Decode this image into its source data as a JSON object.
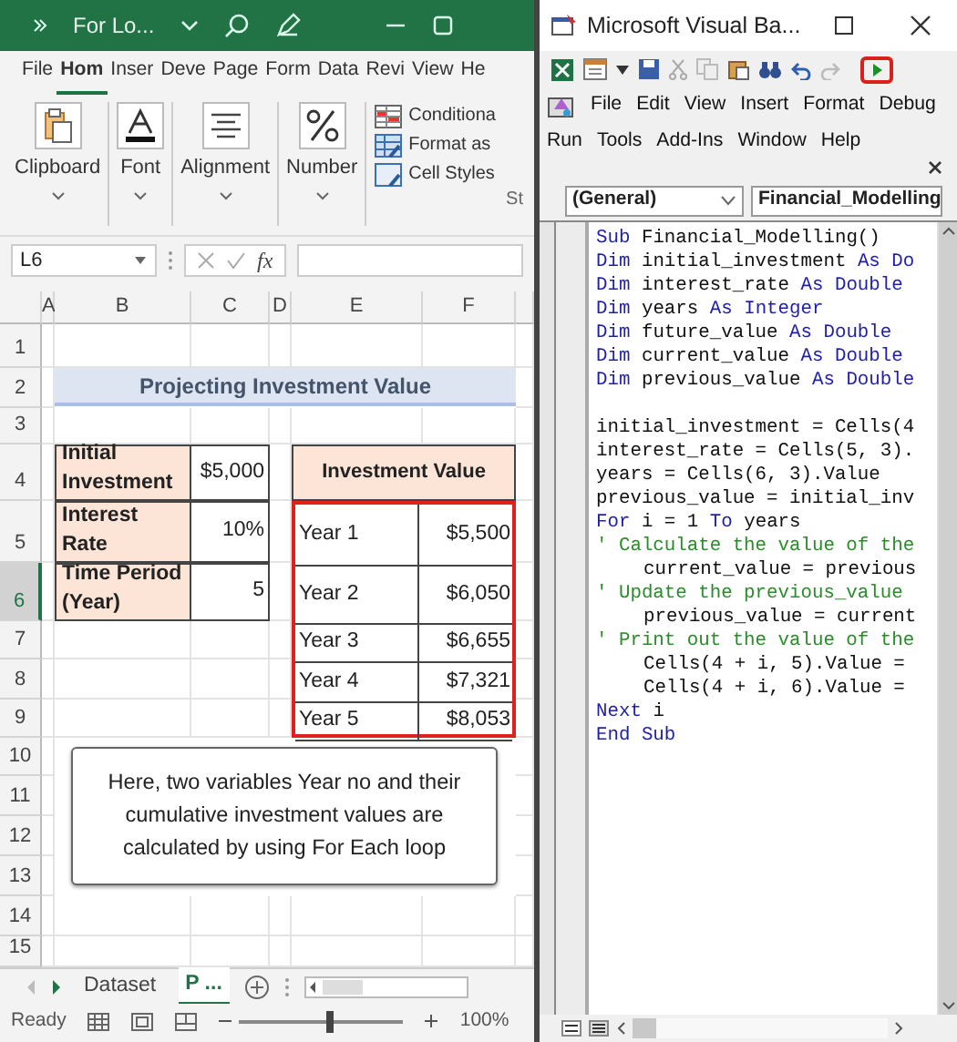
{
  "excel": {
    "title": "For Lo...",
    "ribbon_tabs": [
      {
        "label": "File",
        "selected": false
      },
      {
        "label": "Hom",
        "selected": true
      },
      {
        "label": "Inser",
        "selected": false
      },
      {
        "label": "Deve",
        "selected": false
      },
      {
        "label": "Page",
        "selected": false
      },
      {
        "label": "Form",
        "selected": false
      },
      {
        "label": "Data",
        "selected": false
      },
      {
        "label": "Revi",
        "selected": false
      },
      {
        "label": "View",
        "selected": false
      },
      {
        "label": "He",
        "selected": false
      }
    ],
    "ribbon_groups": [
      {
        "label": "Clipboard",
        "kind": "clipboard"
      },
      {
        "label": "Font",
        "kind": "font"
      },
      {
        "label": "Alignment",
        "kind": "alignment"
      },
      {
        "label": "Number",
        "kind": "number"
      }
    ],
    "styles_items": [
      {
        "label": "Conditiona",
        "kind": "conditional"
      },
      {
        "label": "Format as",
        "kind": "table"
      },
      {
        "label": "Cell Styles",
        "kind": "cellstyles"
      }
    ],
    "styles_group_label": "St",
    "name_box": "L6",
    "function_label": "fx",
    "columns": [
      "A",
      "B",
      "C",
      "D",
      "E",
      "F"
    ],
    "rows": [
      {
        "label": "1",
        "selected": false
      },
      {
        "label": "2",
        "selected": false
      },
      {
        "label": "3",
        "selected": false
      },
      {
        "label": "4",
        "selected": false
      },
      {
        "label": "5",
        "selected": false
      },
      {
        "label": "6",
        "selected": true
      },
      {
        "label": "7",
        "selected": false
      },
      {
        "label": "8",
        "selected": false
      },
      {
        "label": "9",
        "selected": false
      },
      {
        "label": "10",
        "selected": false
      },
      {
        "label": "11",
        "selected": false
      },
      {
        "label": "12",
        "selected": false
      },
      {
        "label": "13",
        "selected": false
      },
      {
        "label": "14",
        "selected": false
      },
      {
        "label": "15",
        "selected": false
      }
    ],
    "banner": "Projecting Investment Value",
    "inputs": [
      {
        "label": "Initial Investment",
        "value": "$5,000"
      },
      {
        "label": "Interest Rate",
        "value": "10%"
      },
      {
        "label": "Time Period (Year)",
        "value": "5"
      }
    ],
    "results_header": "Investment Value",
    "results": [
      {
        "year": "Year 1",
        "value": "$5,500"
      },
      {
        "year": "Year 2",
        "value": "$6,050"
      },
      {
        "year": "Year 3",
        "value": "$6,655"
      },
      {
        "year": "Year 4",
        "value": "$7,321"
      },
      {
        "year": "Year 5",
        "value": "$8,053"
      }
    ],
    "note": "Here, two variables Year no and their cumulative investment values are calculated by using For Each loop",
    "sheet_tabs": [
      {
        "label": "Dataset",
        "selected": false
      },
      {
        "label": "P ...",
        "selected": true
      }
    ],
    "status": "Ready",
    "zoom": {
      "level": 0.55,
      "reading": "100%"
    }
  },
  "vba": {
    "title": "Microsoft Visual Ba...",
    "menu": [
      "File",
      "Edit",
      "View",
      "Insert",
      "Format",
      "Debug",
      "Run",
      "Tools",
      "Add-Ins",
      "Window",
      "Help"
    ],
    "object_box": "(General)",
    "procedure_box": "Financial_Modelling",
    "code": [
      {
        "segments": [
          {
            "kind": "kw",
            "text": "Sub "
          },
          {
            "kind": "tx",
            "text": "Financial_Modelling()"
          }
        ]
      },
      {
        "segments": [
          {
            "kind": "kw",
            "text": "Dim "
          },
          {
            "kind": "tx",
            "text": "initial_investment "
          },
          {
            "kind": "kw",
            "text": "As Do"
          }
        ]
      },
      {
        "segments": [
          {
            "kind": "kw",
            "text": "Dim "
          },
          {
            "kind": "tx",
            "text": "interest_rate "
          },
          {
            "kind": "kw",
            "text": "As Double"
          }
        ]
      },
      {
        "segments": [
          {
            "kind": "kw",
            "text": "Dim "
          },
          {
            "kind": "tx",
            "text": "years "
          },
          {
            "kind": "kw",
            "text": "As Integer"
          }
        ]
      },
      {
        "segments": [
          {
            "kind": "kw",
            "text": "Dim "
          },
          {
            "kind": "tx",
            "text": "future_value "
          },
          {
            "kind": "kw",
            "text": "As Double"
          }
        ]
      },
      {
        "segments": [
          {
            "kind": "kw",
            "text": "Dim "
          },
          {
            "kind": "tx",
            "text": "current_value "
          },
          {
            "kind": "kw",
            "text": "As Double"
          }
        ]
      },
      {
        "segments": [
          {
            "kind": "kw",
            "text": "Dim "
          },
          {
            "kind": "tx",
            "text": "previous_value "
          },
          {
            "kind": "kw",
            "text": "As Double"
          }
        ]
      },
      {
        "blank_before": true,
        "segments": [
          {
            "kind": "tx",
            "text": "initial_investment = Cells(4"
          }
        ]
      },
      {
        "segments": [
          {
            "kind": "tx",
            "text": "interest_rate = Cells(5, 3)."
          }
        ]
      },
      {
        "segments": [
          {
            "kind": "tx",
            "text": "years = Cells(6, 3).Value"
          }
        ]
      },
      {
        "segments": [
          {
            "kind": "tx",
            "text": "previous_value = initial_inv"
          }
        ]
      },
      {
        "segments": [
          {
            "kind": "kw",
            "text": "For "
          },
          {
            "kind": "tx",
            "text": "i = 1 "
          },
          {
            "kind": "kw",
            "text": "To "
          },
          {
            "kind": "tx",
            "text": "years"
          }
        ]
      },
      {
        "segments": [
          {
            "kind": "cm",
            "text": "' Calculate the value of the"
          }
        ]
      },
      {
        "indented": true,
        "segments": [
          {
            "kind": "tx",
            "text": "current_value = previous"
          }
        ]
      },
      {
        "segments": [
          {
            "kind": "cm",
            "text": "' Update the previous_value"
          }
        ]
      },
      {
        "indented": true,
        "segments": [
          {
            "kind": "tx",
            "text": "previous_value = current"
          }
        ]
      },
      {
        "segments": [
          {
            "kind": "cm",
            "text": "' Print out the value of the"
          }
        ]
      },
      {
        "indented": true,
        "segments": [
          {
            "kind": "tx",
            "text": "Cells(4 + i, 5).Value ="
          }
        ]
      },
      {
        "indented": true,
        "segments": [
          {
            "kind": "tx",
            "text": "Cells(4 + i, 6).Value ="
          }
        ]
      },
      {
        "segments": [
          {
            "kind": "kw",
            "text": "Next "
          },
          {
            "kind": "tx",
            "text": "i"
          }
        ]
      },
      {
        "segments": [
          {
            "kind": "kw",
            "text": "End Sub"
          }
        ]
      }
    ]
  }
}
